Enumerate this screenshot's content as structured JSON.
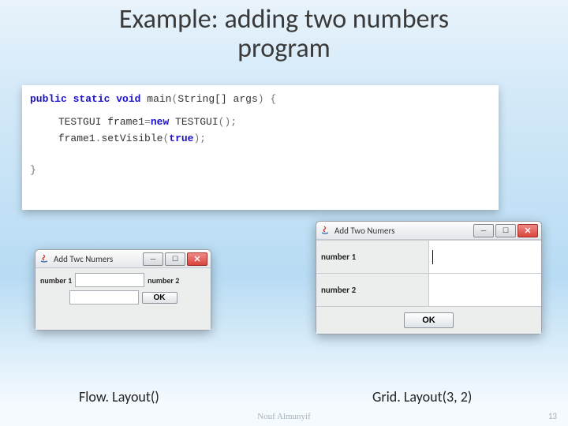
{
  "title_line1": "Example:  adding two numbers",
  "title_line2": "program",
  "code": {
    "kw_public": "public",
    "kw_static": "static",
    "kw_void": "void",
    "main": " main",
    "paren_open": "(",
    "string_arr": "String[]",
    "args": " args",
    "paren_close": ")",
    "brace_open": " {",
    "line2a": "TESTGUI frame1",
    "eq": "=",
    "line2b": "new",
    "line2c": " TESTGUI",
    "line2d": "();",
    "line3a": "frame1",
    "dot1": ".",
    "line3b": "setVisible",
    "line3c": "(",
    "line3d": "true",
    "line3e": ");",
    "brace_close": "}"
  },
  "flowWindow": {
    "title": "Add Twc Numers",
    "label1": "number 1",
    "label2": "number 2",
    "ok": "OK"
  },
  "gridWindow": {
    "title": "Add Two Numers",
    "label1": "number 1",
    "label2": "number 2",
    "ok": "OK"
  },
  "captions": {
    "flow": "Flow. Layout()",
    "grid": "Grid. Layout(3, 2)"
  },
  "footer": "Nouf Almunyif",
  "page": "13",
  "icons": {
    "minimize": "—",
    "maximize": "☐"
  }
}
